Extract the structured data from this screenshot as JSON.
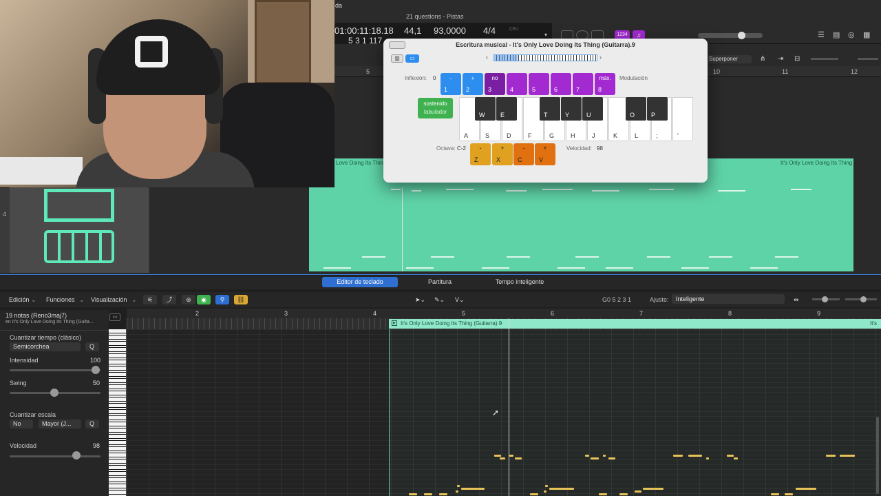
{
  "app": {
    "window_title": "21 questions - Pistas",
    "menu_tail": "da"
  },
  "lcd": {
    "position": "01:00:11:18.18",
    "bars": "5  3  1  117",
    "tempo_small": "44,1",
    "tempo": "93,0000",
    "signature": "4/4",
    "cpu": "CPU"
  },
  "top_badge": "1234",
  "tracks_toolbar": {
    "mode": "Superponer"
  },
  "ruler_top": [
    "5",
    "10",
    "11",
    "12"
  ],
  "track": {
    "number": "4"
  },
  "region": {
    "title_left": "Love Doing Its Thing",
    "title_right": "It's Only Love Doing Its Thing"
  },
  "musical_typing": {
    "title": "Escritura musical - It's Only Love Doing Its Thing (Guitarra).9",
    "pitch_bend_label": "Inflexión:",
    "pitch_bend_value": "0",
    "modulation_label": "Modulación",
    "pads": [
      {
        "top": "-",
        "key": "1"
      },
      {
        "top": "+",
        "key": "2"
      },
      {
        "top": "no",
        "key": "3"
      },
      {
        "top": "",
        "key": "4"
      },
      {
        "top": "",
        "key": "5"
      },
      {
        "top": "",
        "key": "6"
      },
      {
        "top": "",
        "key": "7"
      },
      {
        "top": "máx.",
        "key": "8"
      }
    ],
    "sustain": "sostenido",
    "sustain_key": "tabulador",
    "white_keys": [
      "A",
      "S",
      "D",
      "F",
      "G",
      "H",
      "J",
      "K",
      "L",
      ";",
      "'"
    ],
    "black_keys": [
      "W",
      "E",
      "T",
      "Y",
      "U",
      "O",
      "P"
    ],
    "octave_label": "Octava:",
    "octave_value": "C-2",
    "octave_keys": [
      {
        "top": "-",
        "key": "Z"
      },
      {
        "top": "+",
        "key": "X"
      },
      {
        "top": "-",
        "key": "C"
      },
      {
        "top": "+",
        "key": "V"
      }
    ],
    "velocity_label": "Velocidad:",
    "velocity_value": "98"
  },
  "editor": {
    "tabs": [
      "Editor de teclado",
      "Partitura",
      "Tempo inteligente"
    ],
    "menus": [
      "Edición",
      "Funciones",
      "Visualización"
    ],
    "note_readout": "G0  5 2 3 1",
    "snap_label": "Ajuste:",
    "snap_value": "Inteligente",
    "bar_numbers": [
      "2",
      "3",
      "4",
      "5",
      "6",
      "7",
      "8",
      "9"
    ],
    "region_title": "It's Only Love Doing Its Thing (Guitarra).9",
    "region_title_right": "It's"
  },
  "inspector": {
    "selection": "19 notas (Reno3maj7)",
    "selection_sub": "en It's Only Love Doing Its Thing (Guita...",
    "quantize_time_label": "Cuantizar tiempo (clásico)",
    "quantize_time_value": "Semicorchea",
    "q_button": "Q",
    "strength_label": "Intensidad",
    "strength_value": "100",
    "swing_label": "Swing",
    "swing_value": "50",
    "quantize_scale_label": "Cuantizar escala",
    "scale_root": "No",
    "scale_type": "Mayor (J...",
    "velocity_label": "Velocidad",
    "velocity_value": "98"
  },
  "colors": {
    "region": "#5fd3a8",
    "tab_active": "#2f6fd1",
    "note": "#e8c35a",
    "pad_blue": "#2d8ef0",
    "pad_purple": "#a22ad0",
    "sustain": "#3fb24f"
  }
}
